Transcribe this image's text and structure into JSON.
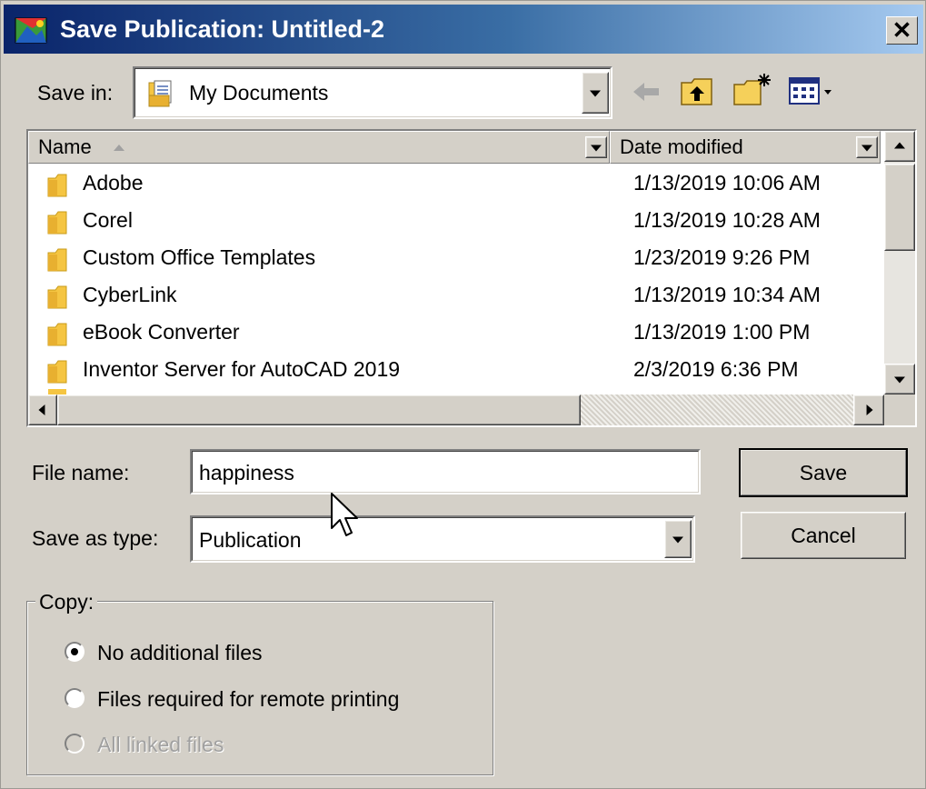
{
  "window": {
    "title": "Save Publication: Untitled-2",
    "close_glyph": "✕"
  },
  "save_in": {
    "label": "Save in:",
    "value": "My Documents",
    "icon": "my-documents-icon"
  },
  "toolbar": {
    "back_icon": "back-arrow-icon",
    "up_icon": "up-one-level-icon",
    "new_folder_icon": "new-folder-icon",
    "view_icon": "view-menu-icon"
  },
  "file_list": {
    "columns": {
      "name": "Name",
      "date": "Date modified"
    },
    "rows": [
      {
        "name": "Adobe",
        "date": "1/13/2019 10:06 AM"
      },
      {
        "name": "Corel",
        "date": "1/13/2019 10:28 AM"
      },
      {
        "name": "Custom Office Templates",
        "date": "1/23/2019 9:26 PM"
      },
      {
        "name": "CyberLink",
        "date": "1/13/2019 10:34 AM"
      },
      {
        "name": "eBook Converter",
        "date": "1/13/2019 1:00 PM"
      },
      {
        "name": "Inventor Server for AutoCAD 2019",
        "date": "2/3/2019 6:36 PM"
      }
    ]
  },
  "file_name": {
    "label": "File name:",
    "value": "happiness"
  },
  "save_as_type": {
    "label": "Save as type:",
    "value": "Publication"
  },
  "buttons": {
    "save": "Save",
    "cancel": "Cancel"
  },
  "copy_group": {
    "label": "Copy:",
    "options": [
      {
        "label": "No additional files",
        "selected": true,
        "enabled": true
      },
      {
        "label": "Files required for remote printing",
        "selected": false,
        "enabled": true
      },
      {
        "label": "All linked files",
        "selected": false,
        "enabled": false
      }
    ]
  },
  "colors": {
    "dialog_bg": "#d4d0c8",
    "title_start": "#0a246a",
    "title_end": "#a6caf0",
    "folder_yellow": "#f5c542"
  }
}
